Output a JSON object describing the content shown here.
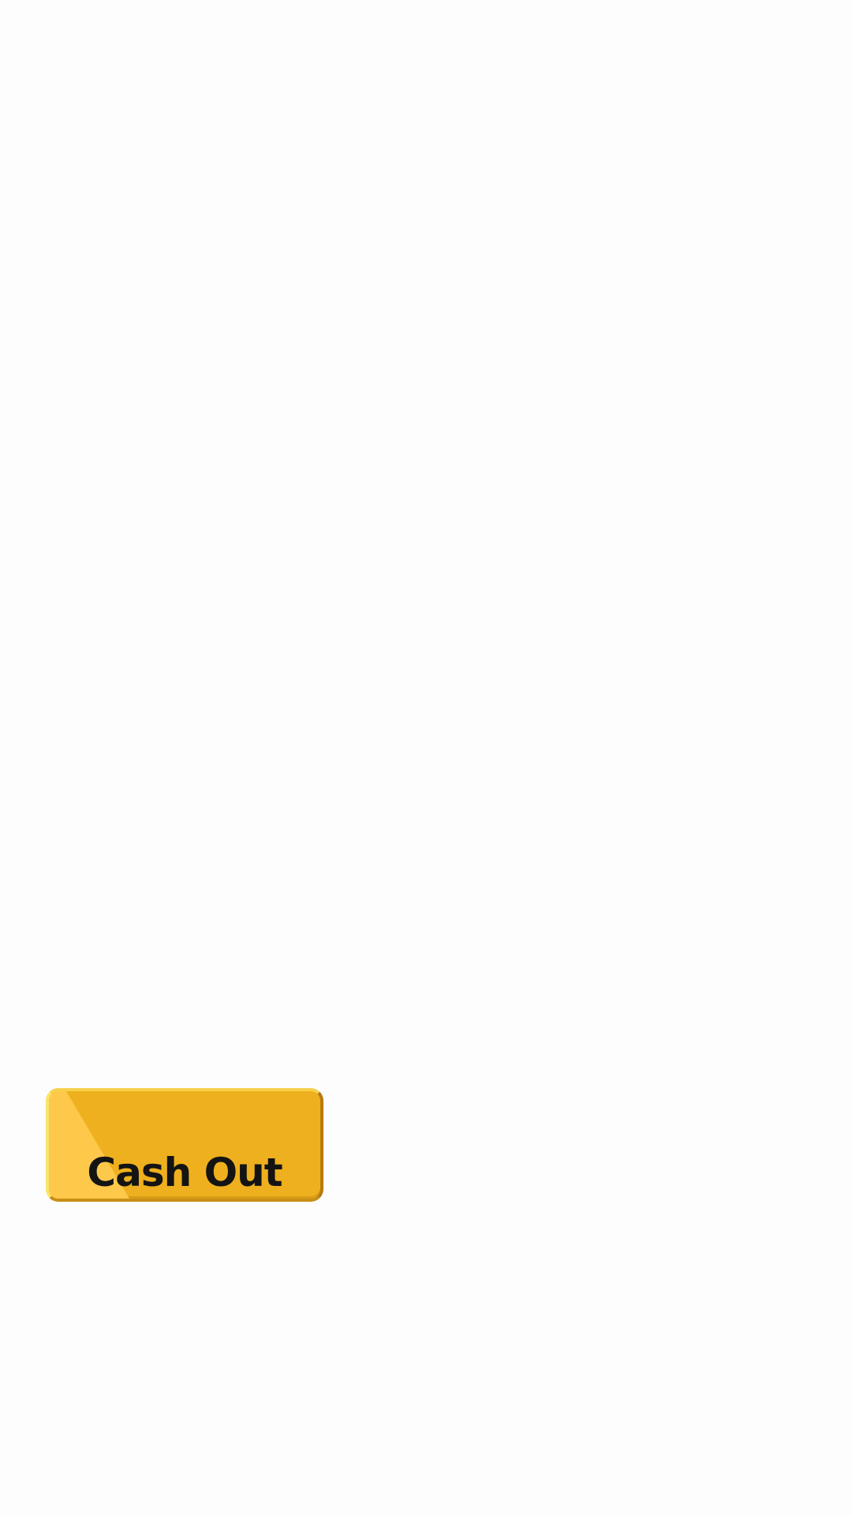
{
  "cash_out": {
    "label": "Cash Out"
  },
  "colors": {
    "background": "#fdfdfd",
    "button_face": "#eeb01e",
    "button_highlight": "#fec84a",
    "button_border_light": "#fbe46a",
    "button_border_dark": "#b77a10",
    "label_text": "#141414"
  }
}
